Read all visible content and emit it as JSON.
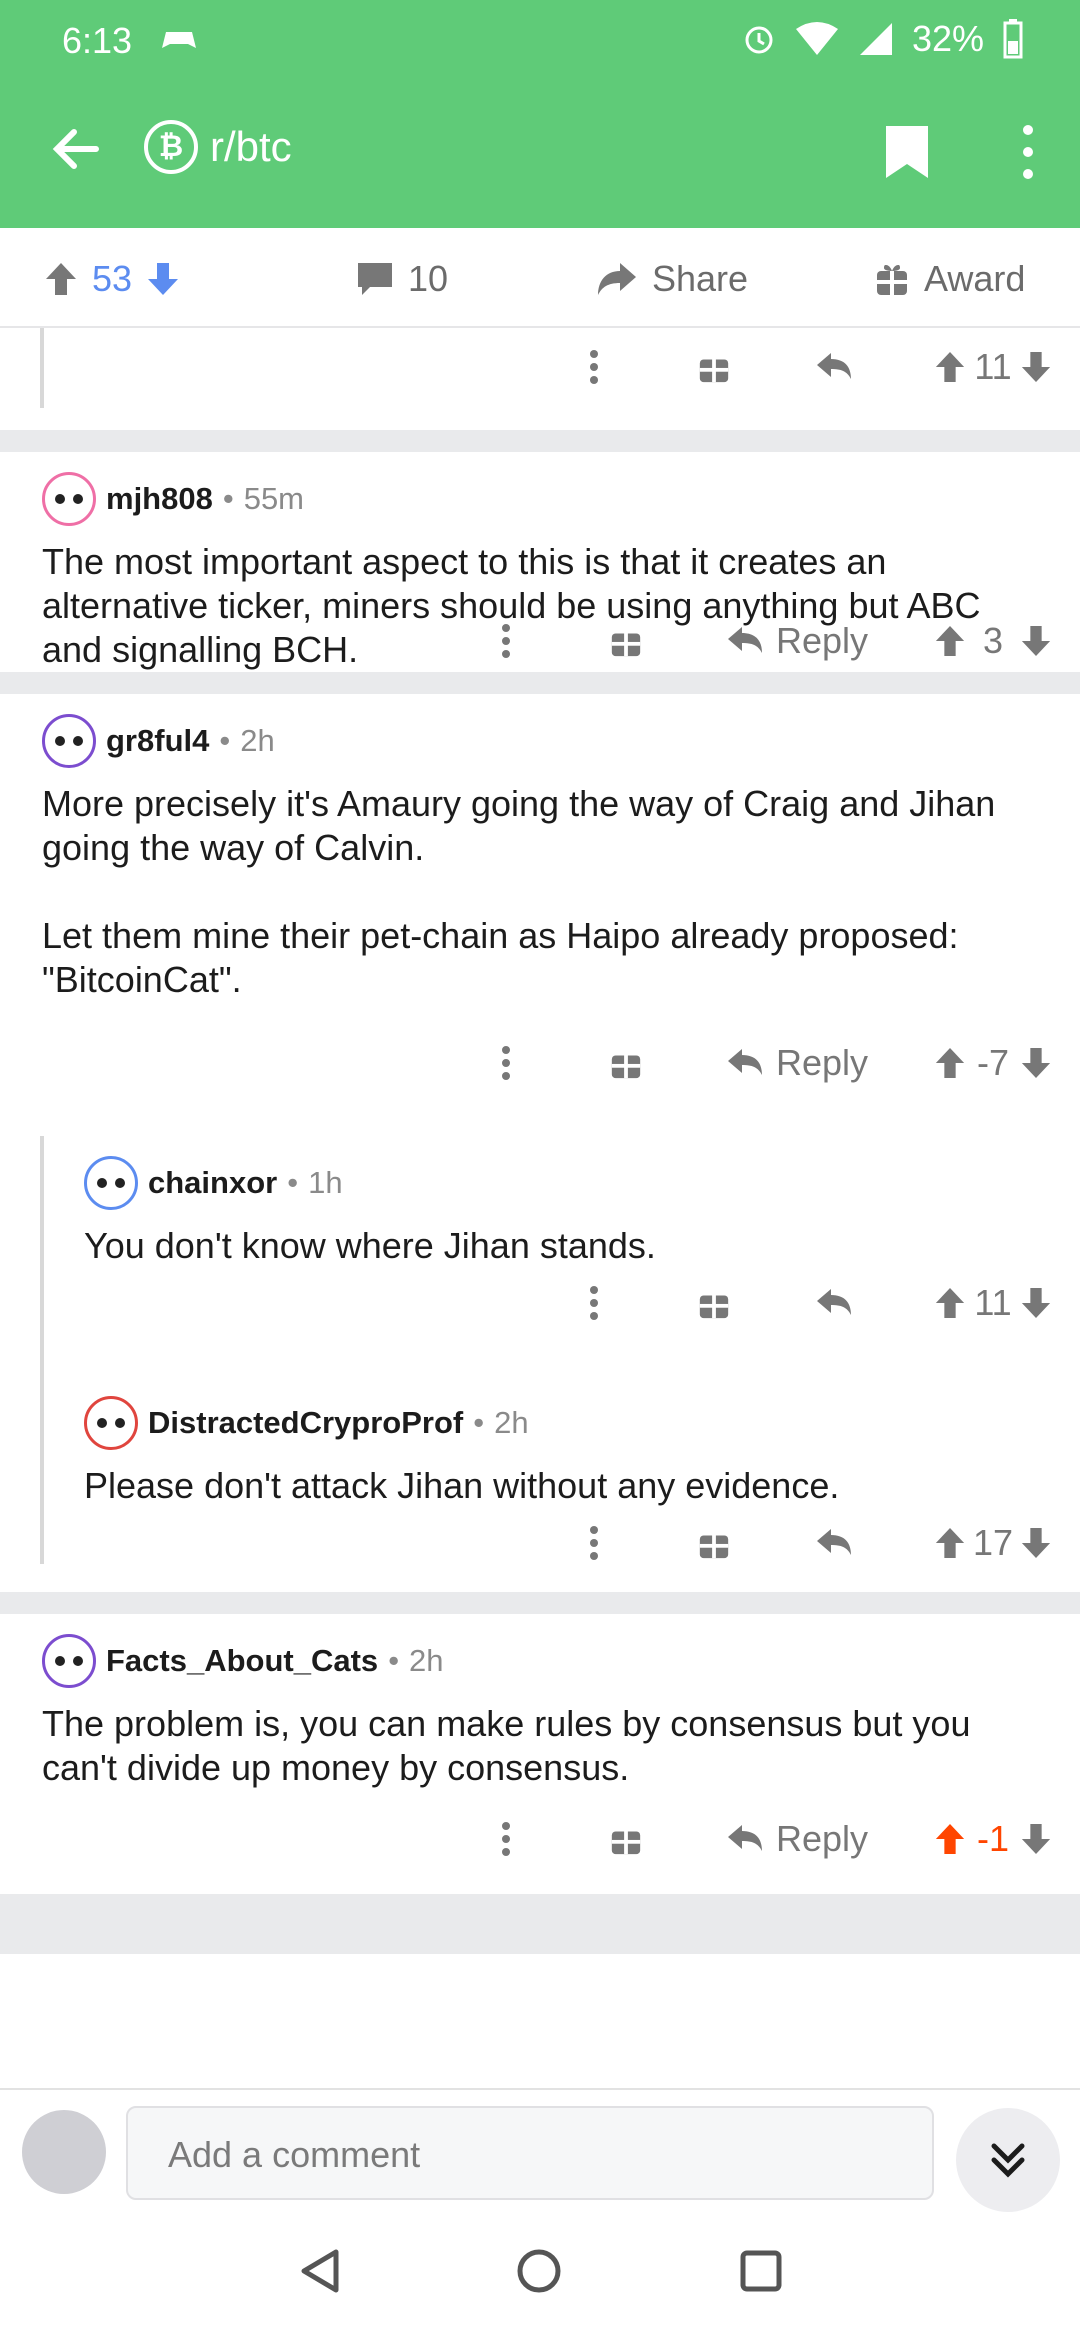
{
  "status": {
    "time": "6:13",
    "battery": "32%"
  },
  "header": {
    "subreddit": "r/btc",
    "sub_icon_glyph": "₿"
  },
  "post_actions": {
    "score": "53",
    "comments": "10",
    "share": "Share",
    "award": "Award"
  },
  "comments": [
    {
      "id": "c0",
      "score": "11"
    },
    {
      "id": "c1",
      "user": "mjh808",
      "age": "55m",
      "text": "The most important aspect to this is that it creates an alternative ticker, miners should be using anything but ABC and signalling BCH.",
      "reply": "Reply",
      "score": "3"
    },
    {
      "id": "c2",
      "user": "gr8ful4",
      "age": "2h",
      "text1": "More precisely it's Amaury going the way of Craig and Jihan going the way of Calvin.",
      "text2": "Let them mine their pet-chain as Haipo already proposed: \"BitcoinCat\".",
      "reply": "Reply",
      "score": "-7"
    },
    {
      "id": "c3",
      "user": "chainxor",
      "age": "1h",
      "text": "You don't know where Jihan stands.",
      "score": "11"
    },
    {
      "id": "c4",
      "user": "DistractedCryproProf",
      "age": "2h",
      "text": "Please don't attack Jihan without any evidence.",
      "score": "17"
    },
    {
      "id": "c5",
      "user": "Facts_About_Cats",
      "age": "2h",
      "text": "The problem is, you can make rules by consensus but you can't divide up money by consensus.",
      "reply": "Reply",
      "score": "-1"
    }
  ],
  "composer": {
    "placeholder": "Add a comment"
  },
  "colors": {
    "header_green": "#5fcb78",
    "upvote_blue": "#5c8cf0",
    "upvote_orange": "#ff4500"
  },
  "icons": [
    "back-arrow-icon",
    "bookmark-icon",
    "more-vert-icon",
    "upvote-icon",
    "downvote-icon",
    "comment-icon",
    "share-icon",
    "award-icon",
    "reply-icon",
    "expand-icon"
  ]
}
